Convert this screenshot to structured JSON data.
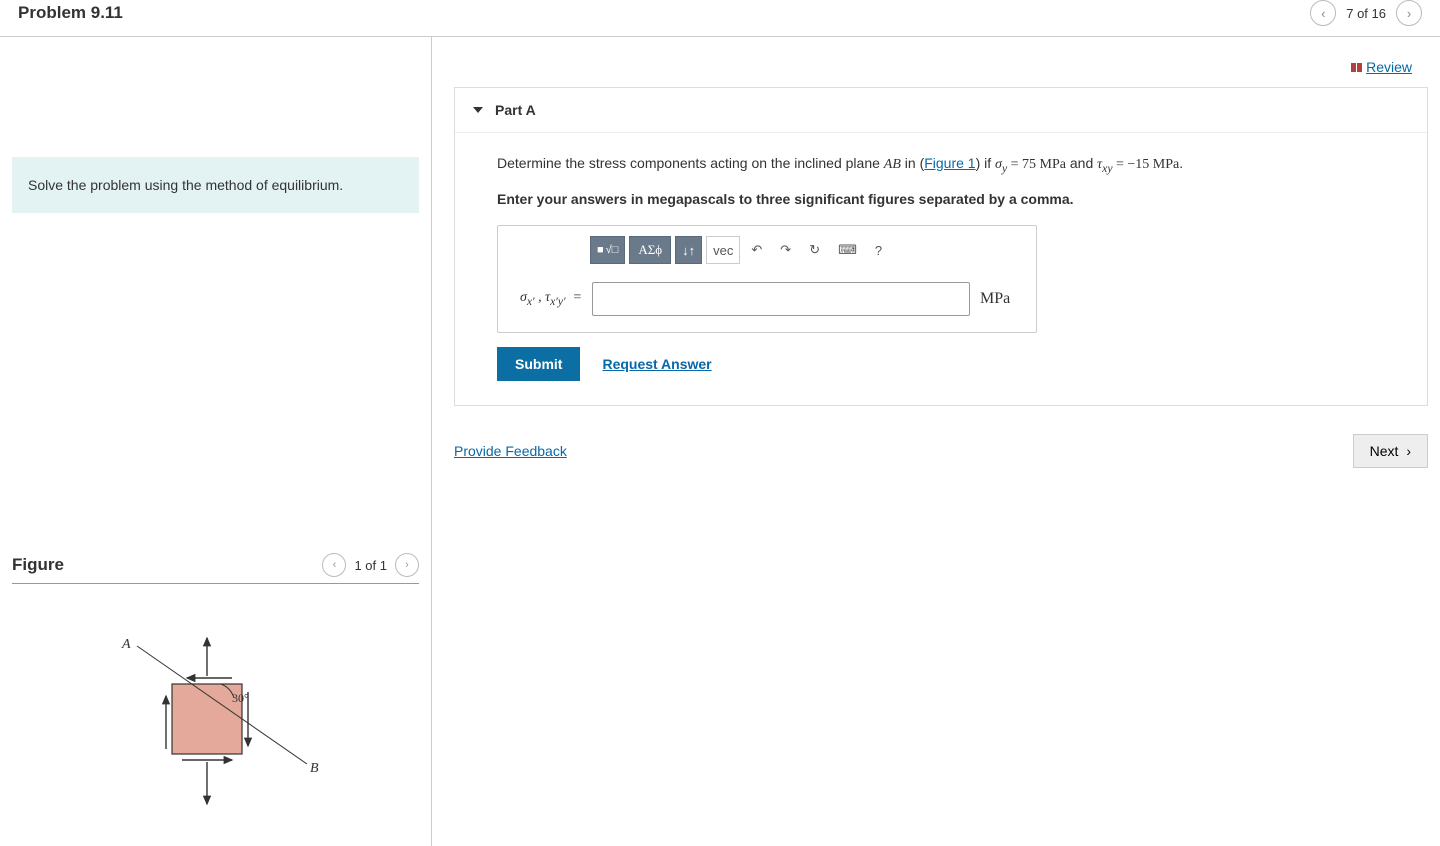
{
  "header": {
    "title": "Problem 9.11",
    "pager": "7 of 16"
  },
  "review_link": "Review",
  "instruction": "Solve the problem using the method of equilibrium.",
  "figure": {
    "title": "Figure",
    "pager": "1 of 1",
    "labels": {
      "A": "A",
      "B": "B",
      "angle": "30°"
    }
  },
  "part": {
    "title": "Part A",
    "prompt_prefix": "Determine the stress components acting on the inclined plane ",
    "prompt_plane": "AB",
    "prompt_in": " in (",
    "figure_link": "Figure 1",
    "prompt_after_link": ") if ",
    "sigma_y_eq": " = 75 MPa",
    "and_text": " and ",
    "tau_eq": " = −15 MPa",
    "period": ".",
    "instruction": "Enter your answers in megapascals to three significant figures separated by a comma.",
    "toolbar": {
      "templates": "□√□",
      "greek": "ΑΣϕ",
      "subscript": "↓↑",
      "vec": "vec",
      "undo": "↶",
      "redo": "↷",
      "reset": "↻",
      "keyboard": "⌨",
      "help": "?"
    },
    "var_label": "σx′ , τx′y′  =",
    "unit": "MPa",
    "submit": "Submit",
    "request": "Request Answer"
  },
  "footer": {
    "feedback": "Provide Feedback",
    "next": "Next"
  }
}
